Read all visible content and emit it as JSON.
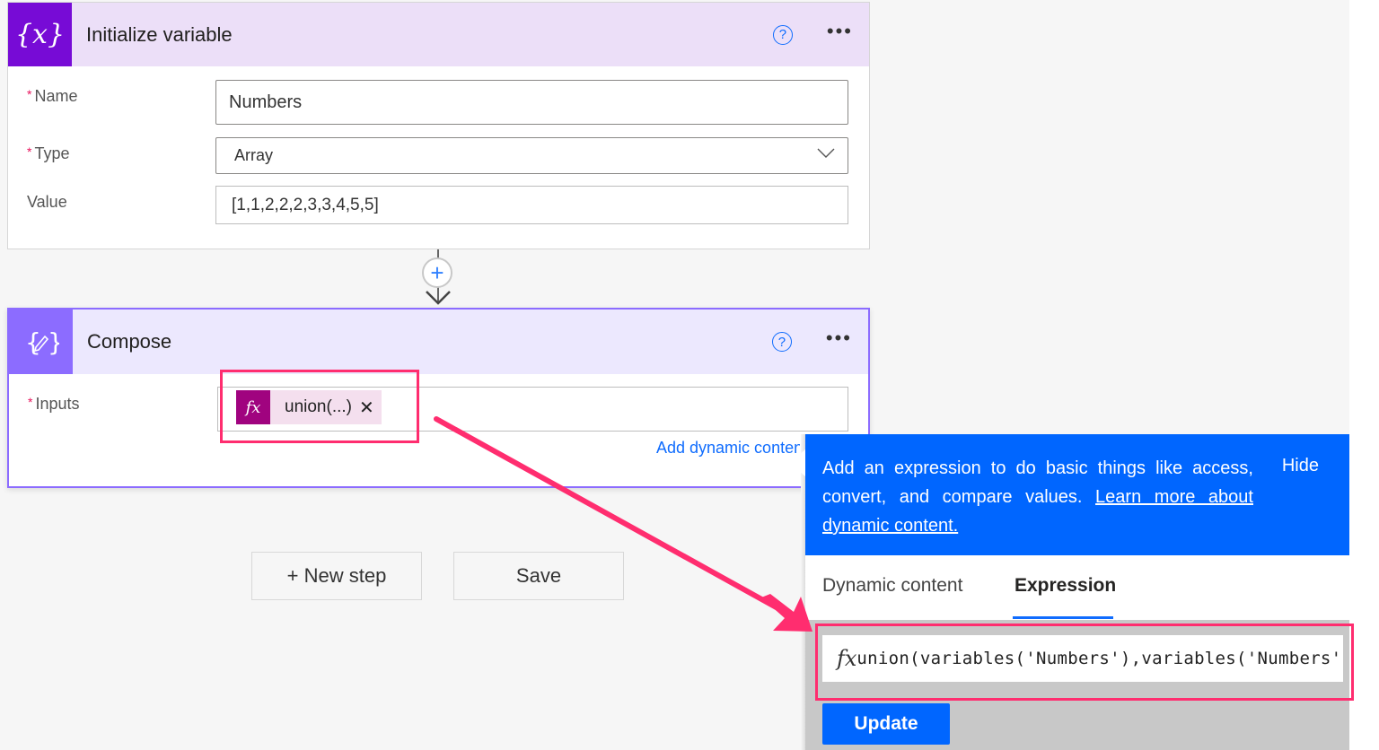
{
  "init_card": {
    "title": "Initialize variable",
    "icon": "variable-icon",
    "help_icon": "help-icon",
    "more_icon": "more-options-icon",
    "more_label": "•••",
    "help_label": "?",
    "fields": {
      "name": {
        "label": "Name",
        "required": true,
        "value": "Numbers"
      },
      "type": {
        "label": "Type",
        "required": true,
        "value": "Array"
      },
      "value": {
        "label": "Value",
        "required": false,
        "value": "[1,1,2,2,2,3,3,4,5,5]"
      }
    },
    "icon_label": "{x}",
    "required_mark": "*"
  },
  "connector": {
    "add_label": "+"
  },
  "compose_card": {
    "title": "Compose",
    "icon": "compose-icon",
    "help_label": "?",
    "more_label": "•••",
    "required_mark": "*",
    "inputs_label": "Inputs",
    "token": {
      "fx_label": "fx",
      "label": "union(...)",
      "close_label": "✕"
    },
    "add_dynamic_label": "Add dynamic content"
  },
  "footer": {
    "new_step_label": "+ New step",
    "save_label": "Save"
  },
  "expression_panel": {
    "banner_text": "Add an expression to do basic things like access, convert, and compare values.",
    "learn_more_link": "Learn more about dynamic content.",
    "hide_label": "Hide",
    "tabs": [
      {
        "label": "Dynamic content",
        "active": false
      },
      {
        "label": "Expression",
        "active": true
      }
    ],
    "fx_label": "fx",
    "expression_value": "union(variables('Numbers'),variables('Numbers'))",
    "update_label": "Update"
  },
  "colors": {
    "init_accent": "#770bd6",
    "compose_accent": "#8c6cff",
    "primary_blue": "#0066ff",
    "annotation_pink": "#ff2d6f",
    "token_fx": "#a0037f"
  }
}
